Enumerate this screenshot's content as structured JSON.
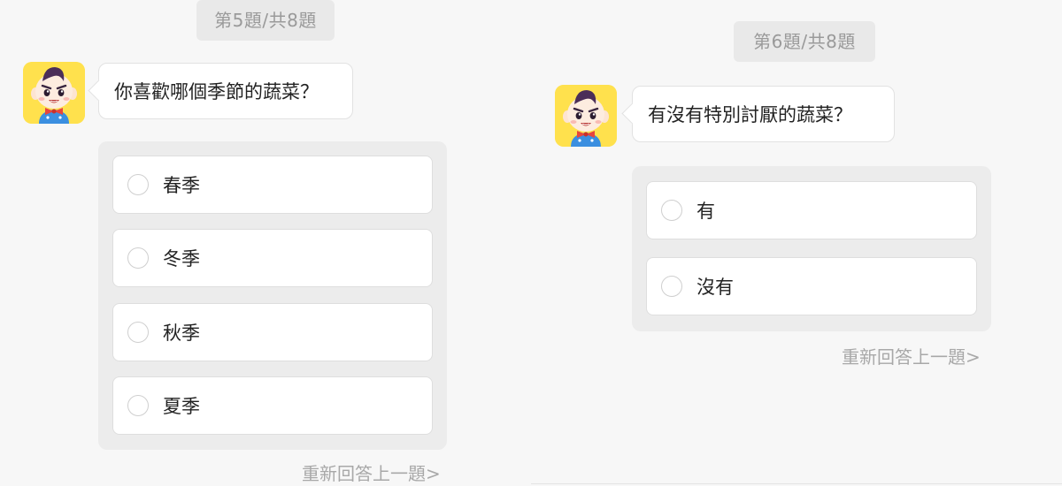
{
  "questions": [
    {
      "progress": "第5題/共8題",
      "text": "你喜歡哪個季節的蔬菜？",
      "options": [
        "春季",
        "冬季",
        "秋季",
        "夏季"
      ],
      "redo": "重新回答上一題>"
    },
    {
      "progress": "第6題/共8題",
      "text": "有沒有特別討厭的蔬菜？",
      "options": [
        "有",
        "沒有"
      ],
      "redo": "重新回答上一題>"
    }
  ],
  "avatar_icon": "cartoon-boy-avatar",
  "colors": {
    "avatar_bg": "#ffe14d",
    "options_bg": "#ececec",
    "page_bg": "#f7f7f7",
    "muted_text": "#9a9a9a"
  }
}
